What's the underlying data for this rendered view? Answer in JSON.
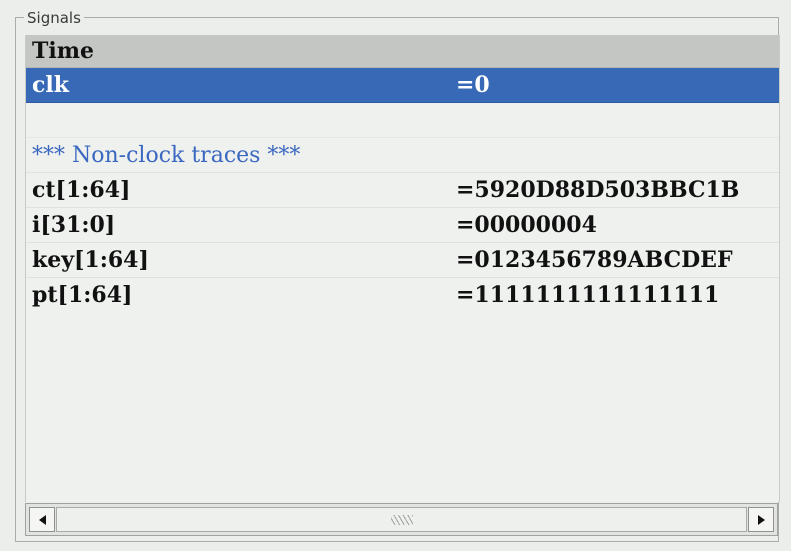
{
  "panel": {
    "title": "Signals"
  },
  "rows": {
    "header": {
      "name": "Time",
      "value": ""
    },
    "clk": {
      "name": "clk",
      "value": "=0"
    },
    "comment": {
      "name": "*** Non-clock traces ***",
      "value": ""
    },
    "ct": {
      "name": "ct[1:64]",
      "value": "=5920D88D503BBC1B"
    },
    "i": {
      "name": "i[31:0]",
      "value": "=00000004"
    },
    "key": {
      "name": "key[1:64]",
      "value": "=0123456789ABCDEF"
    },
    "pt": {
      "name": "pt[1:64]",
      "value": "=1111111111111111"
    }
  },
  "scrollbar": {
    "left_icon": "arrow-left-icon",
    "right_icon": "arrow-right-icon",
    "grip_icon": "grip-icon"
  },
  "colors": {
    "selection": "#3869b6",
    "comment": "#3a67c0",
    "header_bg": "#c4c6c3"
  }
}
